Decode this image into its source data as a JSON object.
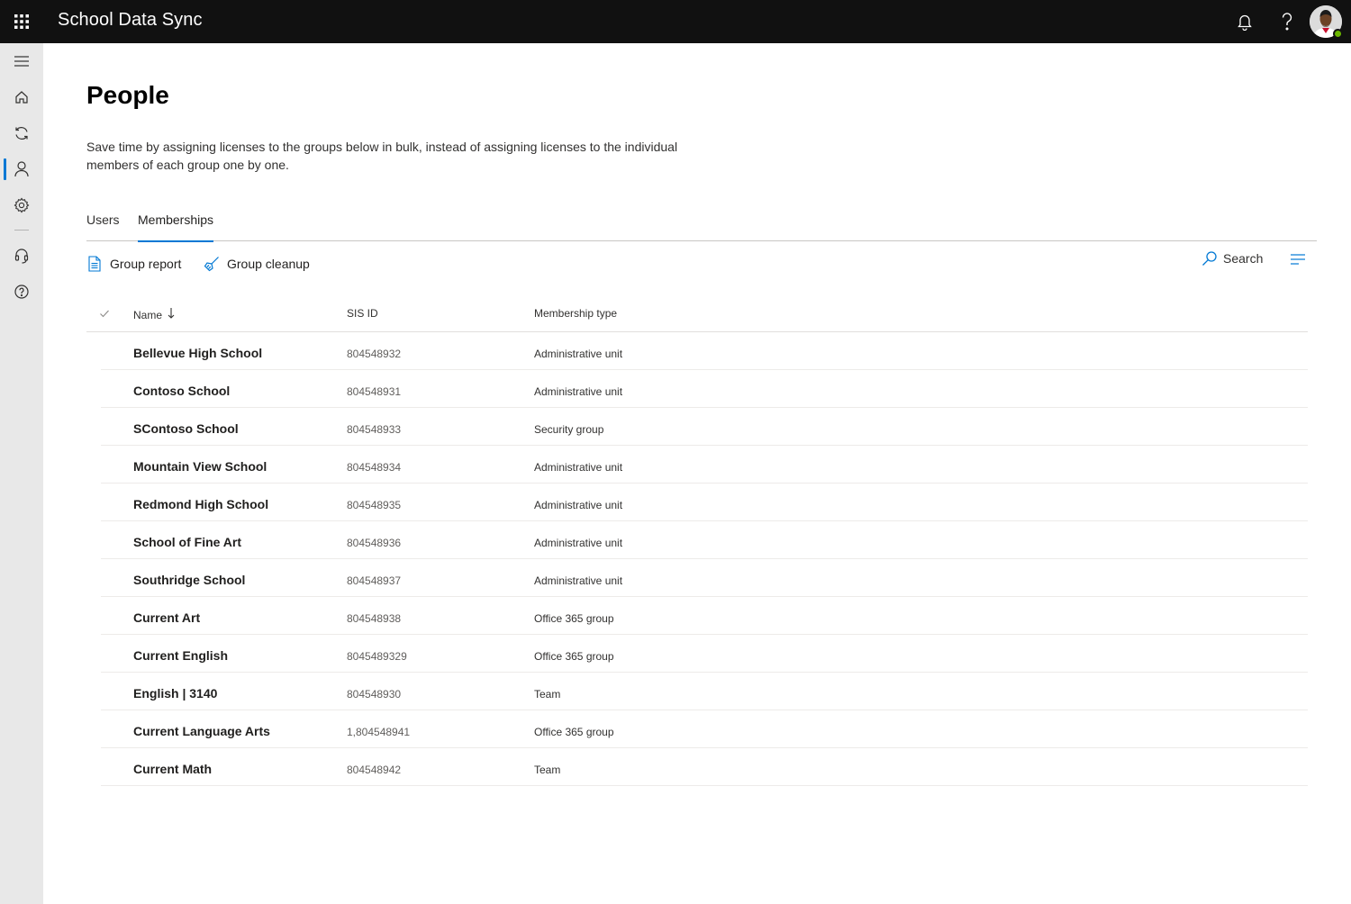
{
  "app": {
    "title": "School Data Sync"
  },
  "colors": {
    "accent": "#0078d4",
    "presence": "#6bb700",
    "topbar": "#111111",
    "rail": "#e8e8e8"
  },
  "topbar": {
    "icons": [
      "waffle-icon",
      "bell-icon",
      "help-icon",
      "avatar"
    ]
  },
  "rail": {
    "items": [
      {
        "name": "menu",
        "icon": "hamburger-icon"
      },
      {
        "name": "home",
        "icon": "home-icon"
      },
      {
        "name": "sync",
        "icon": "sync-icon"
      },
      {
        "name": "people",
        "icon": "person-icon",
        "active": true
      },
      {
        "name": "settings",
        "icon": "gear-icon"
      },
      {
        "name": "support",
        "icon": "headset-icon"
      },
      {
        "name": "help",
        "icon": "help-circle-icon"
      }
    ]
  },
  "page": {
    "title": "People",
    "description": "Save time by assigning licenses to the groups below in bulk, instead of assigning licenses to the individual members of each group one by one."
  },
  "tabs": [
    {
      "label": "Users",
      "active": false
    },
    {
      "label": "Memberships",
      "active": true
    }
  ],
  "commands": {
    "group_report": "Group report",
    "group_cleanup": "Group cleanup",
    "search": "Search"
  },
  "table": {
    "columns": {
      "name": "Name",
      "sis_id": "SIS ID",
      "type": "Membership type"
    },
    "rows": [
      {
        "name": "Bellevue High School",
        "sis_id": "804548932",
        "type": "Administrative unit"
      },
      {
        "name": "Contoso School",
        "sis_id": "804548931",
        "type": "Administrative unit"
      },
      {
        "name": "SContoso School",
        "sis_id": "804548933",
        "type": "Security group"
      },
      {
        "name": "Mountain View School",
        "sis_id": "804548934",
        "type": "Administrative unit"
      },
      {
        "name": "Redmond High School",
        "sis_id": "804548935",
        "type": "Administrative unit"
      },
      {
        "name": "School of Fine Art",
        "sis_id": "804548936",
        "type": "Administrative unit"
      },
      {
        "name": "Southridge School",
        "sis_id": "804548937",
        "type": "Administrative unit"
      },
      {
        "name": "Current Art",
        "sis_id": "804548938",
        "type": "Office 365 group"
      },
      {
        "name": "Current English",
        "sis_id": "8045489329",
        "type": "Office 365 group"
      },
      {
        "name": "English | 3140",
        "sis_id": "804548930",
        "type": "Team"
      },
      {
        "name": "Current Language Arts",
        "sis_id": "1,804548941",
        "type": "Office 365 group"
      },
      {
        "name": "Current Math",
        "sis_id": "804548942",
        "type": "Team"
      }
    ]
  }
}
